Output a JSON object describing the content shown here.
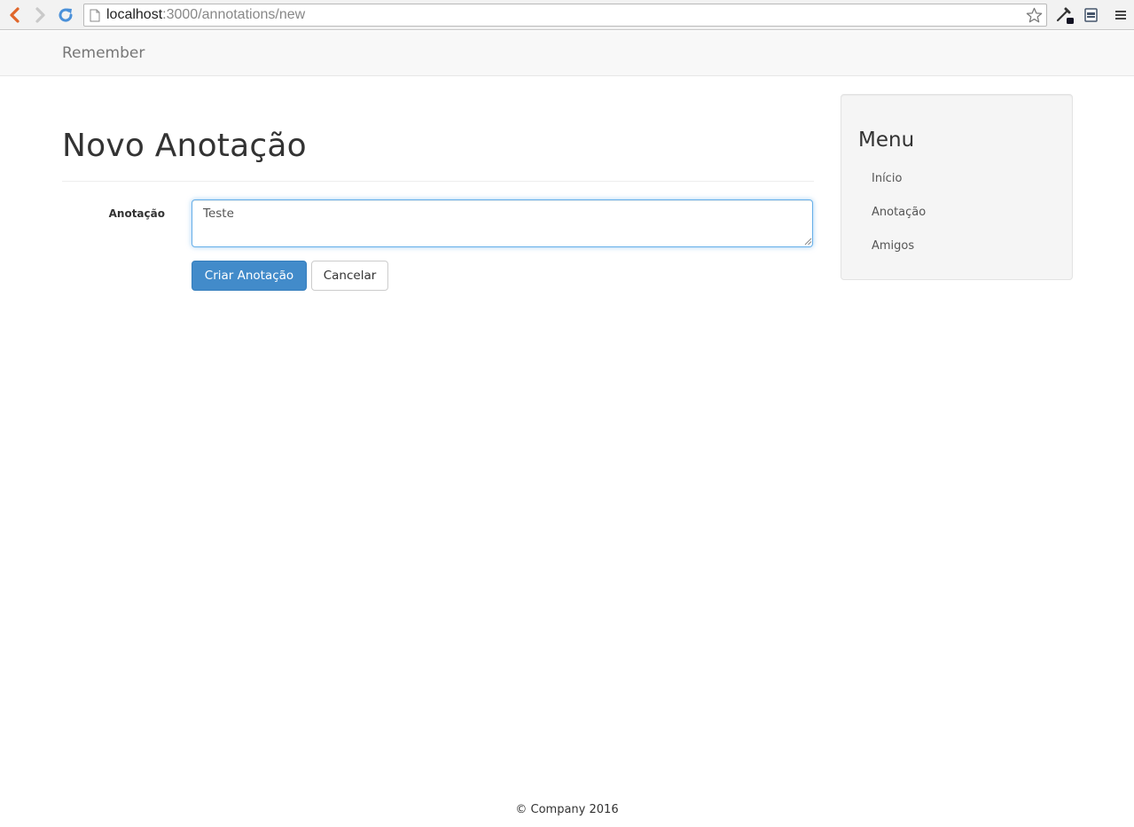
{
  "browser": {
    "url_host": "localhost",
    "url_path": ":3000/annotations/new",
    "icons": {
      "back": "chevron-left-icon",
      "forward": "chevron-right-icon",
      "reload": "reload-icon",
      "page": "page-icon",
      "bookmark": "star-icon",
      "eyedropper": "eyedropper-icon",
      "extension": "extension-icon",
      "menu": "hamburger-menu-icon"
    },
    "colors": {
      "back_arrow": "#e0662a",
      "reload": "#4a90d9"
    }
  },
  "navbar": {
    "brand": "Remember"
  },
  "main": {
    "title": "Novo Anotação",
    "form": {
      "field_label": "Anotação",
      "field_value": "Teste",
      "submit_label": "Criar Anotação",
      "cancel_label": "Cancelar"
    }
  },
  "sidebar": {
    "title": "Menu",
    "items": [
      {
        "label": "Início"
      },
      {
        "label": "Anotação"
      },
      {
        "label": "Amigos"
      }
    ]
  },
  "footer": {
    "text": "© Company 2016"
  },
  "colors": {
    "primary": "#428bca",
    "focus": "#66afe9"
  }
}
